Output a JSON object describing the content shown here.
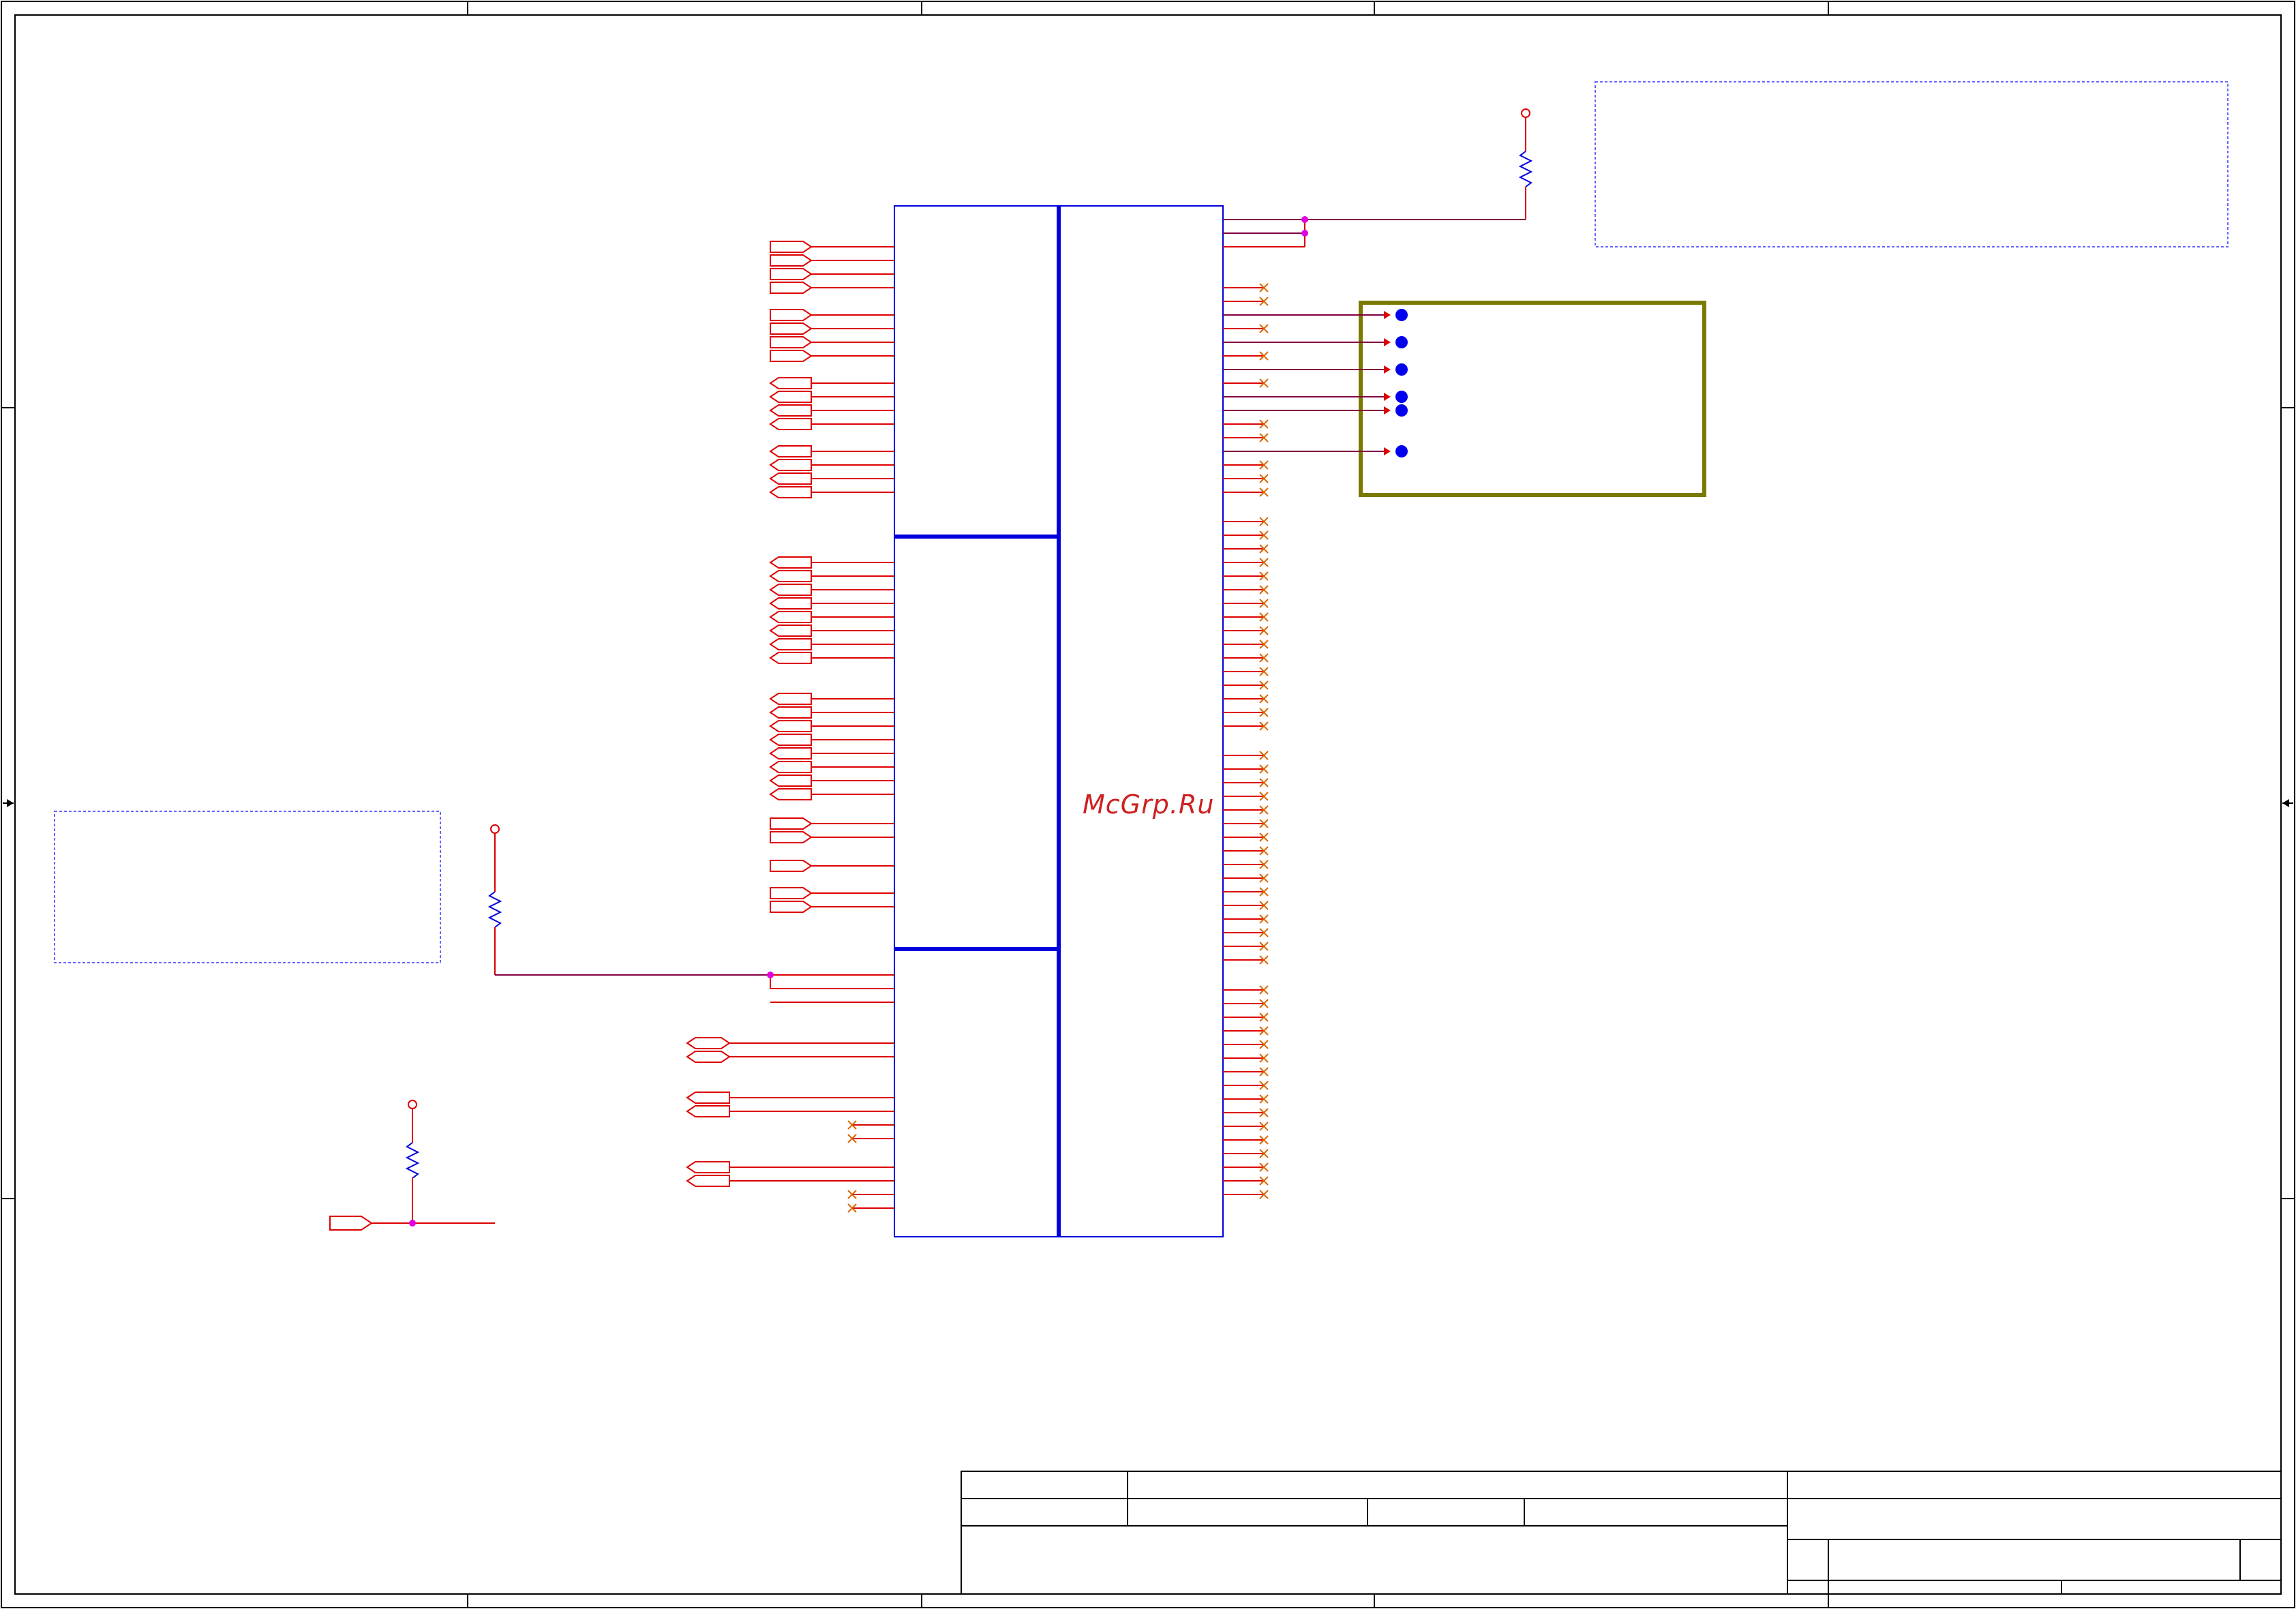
{
  "watermark": {
    "text": "McGrp.Ru"
  },
  "colors": {
    "frame": "#000000",
    "wire": "#dd0000",
    "bus_wire": "#800040",
    "component": "#0000dd",
    "junction": "#e000e0",
    "connector_box": "#7a7a00",
    "note_box": "#6666ff",
    "no_connect": "#dd6600"
  },
  "icons": {
    "resistor": "resistor-icon",
    "power_flag": "power-flag-icon",
    "no_connect": "no-connect-icon",
    "junction": "junction-dot-icon",
    "port": "hierarchical-port-icon",
    "test_point": "test-point-icon"
  },
  "title_block": {
    "fields": []
  }
}
